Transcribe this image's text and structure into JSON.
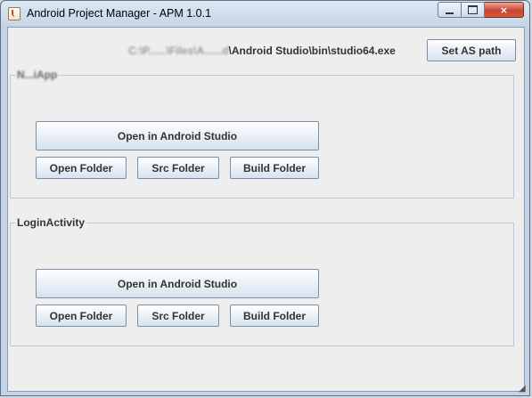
{
  "window": {
    "title": "Android Project Manager - APM 1.0.1",
    "app_icon": "java-cup-icon",
    "controls": {
      "minimize": "minimize-icon",
      "maximize": "maximize-icon",
      "close": "×"
    }
  },
  "toolbar": {
    "path_redacted": "C:\\P......\\Files\\A......d",
    "path_visible": "\\Android Studio\\bin\\studio64.exe",
    "set_path_label": "Set AS path"
  },
  "projects": [
    {
      "name": "N...iApp",
      "open_as_label": "Open in Android Studio",
      "open_folder_label": "Open Folder",
      "src_folder_label": "Src Folder",
      "build_folder_label": "Build Folder"
    },
    {
      "name": "LoginActivity",
      "open_as_label": "Open in Android Studio",
      "open_folder_label": "Open Folder",
      "src_folder_label": "Src Folder",
      "build_folder_label": "Build Folder"
    }
  ],
  "colors": {
    "window_frame": "#c4d3e5",
    "client_bg": "#eeeeee",
    "group_border": "#b7c8d9",
    "close_button": "#c8442d"
  }
}
